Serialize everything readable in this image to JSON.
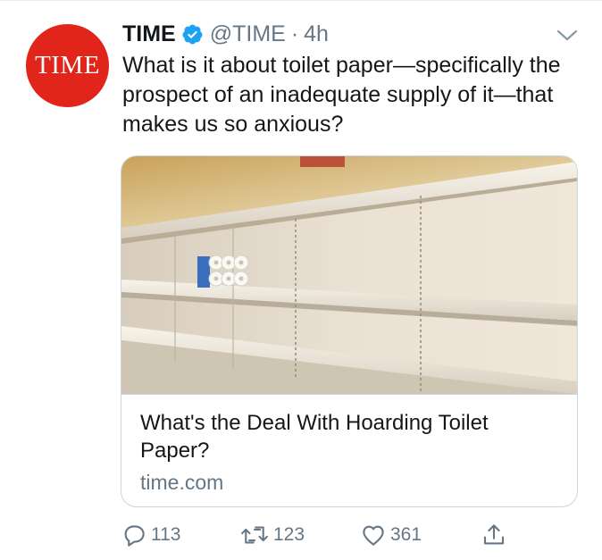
{
  "avatar": {
    "text": "TIME",
    "color": "#e1251b"
  },
  "author": {
    "display_name": "TIME",
    "handle": "@TIME",
    "separator": "·",
    "time_ago": "4h",
    "verified_color": "#1da1f2"
  },
  "tweet": {
    "text": "What is it about toilet paper—specifically the prospect of an inadequate supply of it—that makes us so anxious?"
  },
  "card": {
    "title": "What's the Deal With Hoarding Toilet Paper?",
    "domain": "time.com",
    "image_icon": "empty-store-shelves-photo"
  },
  "actions": {
    "reply_count": "113",
    "retweet_count": "123",
    "like_count": "361",
    "icons": [
      "reply-icon",
      "retweet-icon",
      "like-icon",
      "share-icon"
    ]
  },
  "colors": {
    "text": "#14171a",
    "muted": "#657786",
    "border": "#ccd6dd"
  }
}
